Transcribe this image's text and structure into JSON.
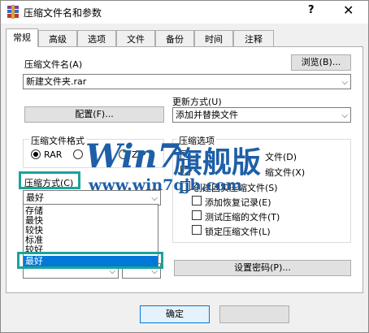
{
  "window": {
    "title": "压缩文件名和参数",
    "help": "?",
    "close": "✕"
  },
  "tabs": [
    {
      "label": "常规",
      "active": true
    },
    {
      "label": "高级"
    },
    {
      "label": "选项"
    },
    {
      "label": "文件"
    },
    {
      "label": "备份"
    },
    {
      "label": "时间"
    },
    {
      "label": "注释"
    }
  ],
  "general": {
    "archive_name_label": "压缩文件名(A)",
    "browse_label": "浏览(B)...",
    "archive_name_value": "新建文件夹.rar",
    "update_mode_label": "更新方式(U)",
    "update_mode_value": "添加并替换文件",
    "profile_label": "配置(F)...",
    "format_group_label": "压缩文件格式",
    "format_options": [
      "RAR",
      "RAR4",
      "ZIP"
    ],
    "format_visible": {
      "rar": "RAR",
      "zip": "ZIP"
    },
    "method_label": "压缩方式(C)",
    "method_value": "最好",
    "method_options": [
      "存储",
      "最快",
      "较快",
      "标准",
      "较好",
      "最好"
    ],
    "options_group_label": "压缩选项",
    "options": {
      "delete_after": "文件(D)",
      "sfx": "缩文件(X)",
      "solid": "创建固实压缩文件(S)",
      "recovery": "添加恢复记录(E)",
      "test": "测试压缩的文件(T)",
      "lock": "锁定压缩文件(L)"
    },
    "set_password_label": "设置密码(P)..."
  },
  "footer": {
    "ok_label": "确定"
  },
  "watermark": {
    "brand": "Win7",
    "brand_cn": "旗舰版",
    "url": "www.win7qjb.com"
  },
  "colors": {
    "highlight": "#1aa39b",
    "selection": "#0078d7",
    "watermark": "#1e5fa8"
  }
}
